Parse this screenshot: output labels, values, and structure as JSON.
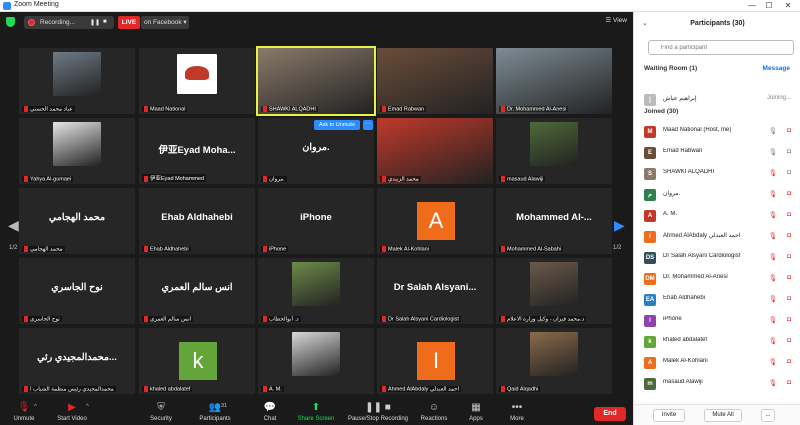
{
  "window": {
    "title": "Zoom Meeting",
    "minimize": "—",
    "maximize": "☐",
    "close": "✕"
  },
  "topbar": {
    "recording_label": "Recording...",
    "pause": "❚❚",
    "stop": "■",
    "live": "LIVE",
    "live_target": "on Facebook ▾",
    "view": "☰ View"
  },
  "tiles": [
    {
      "name": "عباد محمد الحسني",
      "kind": "photo",
      "photo_color": "#6f7b86"
    },
    {
      "name": "Maad National",
      "kind": "logo",
      "photo_color": "#ffffff"
    },
    {
      "name": "SHAWKI ALQADHI",
      "kind": "photo",
      "photo_color": "#8a7a6a",
      "active": true
    },
    {
      "name": "Emad Rabwan",
      "kind": "photo",
      "photo_color": "#6a4d3a"
    },
    {
      "name": "Dr. Mohammed Al-Anesi",
      "kind": "photo",
      "photo_color": "#7e8c95"
    },
    {
      "name": "Yahya Al-gumaei",
      "kind": "photo",
      "photo_color": "#e6e6e6"
    },
    {
      "name": "伊亚Eyad Mohammed",
      "kind": "text",
      "display": "伊亚Eyad Moha..."
    },
    {
      "name": "مروان.",
      "kind": "text",
      "display": "مروان."
    },
    {
      "name": "محمد الزبيدي",
      "kind": "photo",
      "photo_color": "#c0392b"
    },
    {
      "name": "masaud Alawiji",
      "kind": "photo",
      "photo_color": "#4f6a3a"
    },
    {
      "name": "محمد الهجامي",
      "kind": "text",
      "display": "محمد الهجامي"
    },
    {
      "name": "Ehab Aldhahebi",
      "kind": "text",
      "display": "Ehab Aldhahebi"
    },
    {
      "name": "iPhone",
      "kind": "text",
      "display": "iPhone"
    },
    {
      "name": "Malek Al-Kohlani",
      "kind": "letter",
      "display": "A",
      "photo_color": "#ef6c1a"
    },
    {
      "name": "Mohammed Al-Sabahi",
      "kind": "text",
      "display": "Mohammed Al-..."
    },
    {
      "name": "نوح الجاسري",
      "kind": "text",
      "display": "نوح الجاسري"
    },
    {
      "name": "انس سالم العمري",
      "kind": "text",
      "display": "انس سالم العمري"
    },
    {
      "name": "د. أبوالخطاب",
      "kind": "photo",
      "photo_color": "#6e8b4a"
    },
    {
      "name": "Dr Salah Alsyani Cardiologist",
      "kind": "text",
      "display": "Dr Salah Alsyani..."
    },
    {
      "name": "د.محمد قيزان - وكيل وزارة الاعلام",
      "kind": "photo",
      "photo_color": "#6b5a4a"
    },
    {
      "name": "محمدالمجيدي رئيس منظمة الشباب ا",
      "kind": "text",
      "display": "محمدالمجيدي رئي..."
    },
    {
      "name": "khaled abdalatef",
      "kind": "letter",
      "display": "k",
      "photo_color": "#64a53a"
    },
    {
      "name": "A. M.",
      "kind": "photo",
      "photo_color": "#d9d9d9"
    },
    {
      "name": "Ahmed AlAbdaly احمد العبدلي",
      "kind": "letter",
      "display": "I",
      "photo_color": "#ef6c1a"
    },
    {
      "name": "Qaid Alqadhi",
      "kind": "photo",
      "photo_color": "#8b6b4a"
    }
  ],
  "ask_to_unmute": "Ask to Unmute",
  "more_dots": "···",
  "pager_left": "1/2",
  "pager_right": "1/2",
  "toolbar": {
    "unmute": "Unmute",
    "start_video": "Start Video",
    "security": "Security",
    "participants": "Participants",
    "participants_count": "31",
    "chat": "Chat",
    "share_screen": "Share Screen",
    "pause_stop_recording": "Pause/Stop Recording",
    "reactions": "Reactions",
    "apps": "Apps",
    "more": "More",
    "end": "End"
  },
  "panel": {
    "title": "Participants (30)",
    "search_placeholder": "Find a participant",
    "waiting_room": "Waiting Room (1)",
    "message": "Message",
    "waiting": [
      {
        "name": "إبراهيم عياش",
        "status": "Joining...",
        "initial": "إ",
        "color": "#bbbbbb"
      }
    ],
    "joined_header": "Joined (30)",
    "joined": [
      {
        "name": "Maad National (Host, me)",
        "color": "#c0392b",
        "initial": "M",
        "mic": "on",
        "cam": "off"
      },
      {
        "name": "Emad Rabwan",
        "color": "#6a4d3a",
        "initial": "E",
        "mic": "on",
        "cam": "on"
      },
      {
        "name": "SHAWKI ALQADHI",
        "color": "#8a7a6a",
        "initial": "S",
        "mic": "off",
        "cam": "on"
      },
      {
        "name": "مروان.",
        "color": "#2f7f4f",
        "initial": "م",
        "mic": "off",
        "cam": "off"
      },
      {
        "name": "A. M.",
        "color": "#c0392b",
        "initial": "A",
        "mic": "off",
        "cam": "off"
      },
      {
        "name": "Ahmed AlAbdaly احمد العبدلي",
        "color": "#ef6c1a",
        "initial": "I",
        "mic": "off",
        "cam": "off"
      },
      {
        "name": "Dr Salah Alsyani Cardiologist",
        "color": "#334d5c",
        "initial": "DS",
        "mic": "off",
        "cam": "off"
      },
      {
        "name": "Dr. Mohammed Al-Anesi",
        "color": "#ef6c1a",
        "initial": "DM",
        "mic": "off",
        "cam": "off"
      },
      {
        "name": "Ehab Aldhahebi",
        "color": "#2d7fbf",
        "initial": "EA",
        "mic": "off",
        "cam": "off"
      },
      {
        "name": "iPhone",
        "color": "#8e44ad",
        "initial": "I",
        "mic": "off",
        "cam": "off"
      },
      {
        "name": "khaled abdalatef",
        "color": "#64a53a",
        "initial": "k",
        "mic": "off",
        "cam": "off"
      },
      {
        "name": "Malek Al-Kohlani",
        "color": "#ef6c1a",
        "initial": "A",
        "mic": "off",
        "cam": "off"
      },
      {
        "name": "masaud Alawiji",
        "color": "#4f6a3a",
        "initial": "m",
        "mic": "off",
        "cam": "off"
      }
    ],
    "invite": "Invite",
    "mute_all": "Mute All",
    "more": "..."
  }
}
